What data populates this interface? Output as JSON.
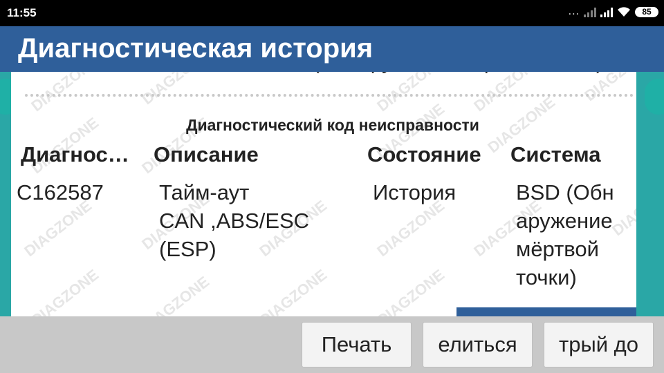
{
  "status_bar": {
    "time": "11:55",
    "dots": "...",
    "battery": "85"
  },
  "header": {
    "title": "Диагностическая история"
  },
  "content": {
    "cut_off_text": "(Обнаружение мёртвой точки)",
    "table_caption": "Диагностический код неисправности",
    "columns": [
      "Диагнос…",
      "Описание",
      "Состояние",
      "Система"
    ],
    "rows": [
      {
        "code": "C162587",
        "description_lines": [
          "Тайм-аут",
          "CAN ,ABS/ESC",
          "(ESP)"
        ],
        "status": "История",
        "system_lines": [
          "BSD (Обн",
          "аружение",
          "мёртвой",
          "точки)"
        ]
      }
    ],
    "watermark": "DIAGZONE"
  },
  "buttons": {
    "print": "Печать",
    "share": "елиться",
    "quick": "трый до"
  },
  "colors": {
    "header_bg": "#2f5f9a",
    "background": "#2aa7a6",
    "bottom_bar": "#c8c8c8"
  }
}
